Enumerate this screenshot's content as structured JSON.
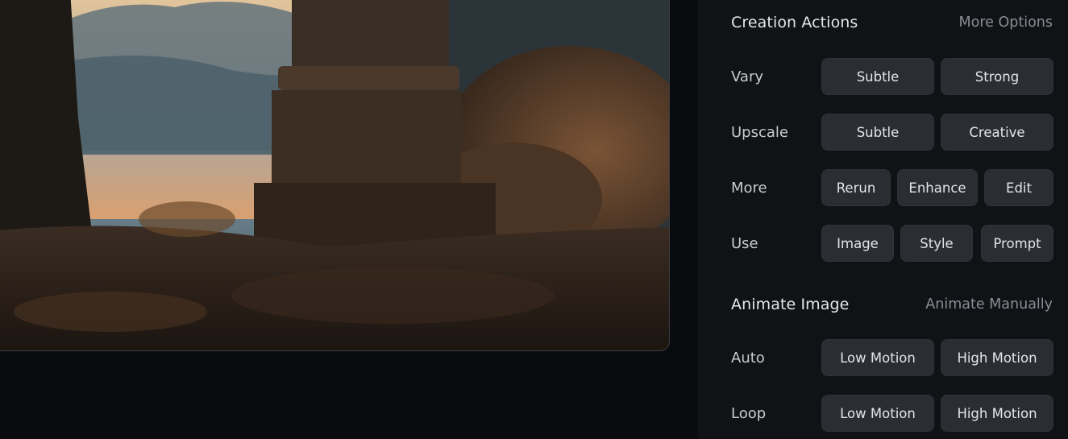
{
  "creation": {
    "title": "Creation Actions",
    "link": "More Options",
    "rows": [
      {
        "label": "Vary",
        "buttons": [
          "Subtle",
          "Strong"
        ]
      },
      {
        "label": "Upscale",
        "buttons": [
          "Subtle",
          "Creative"
        ]
      },
      {
        "label": "More",
        "buttons": [
          "Rerun",
          "Enhance",
          "Edit"
        ]
      },
      {
        "label": "Use",
        "buttons": [
          "Image",
          "Style",
          "Prompt"
        ]
      }
    ]
  },
  "animate": {
    "title": "Animate Image",
    "link": "Animate Manually",
    "rows": [
      {
        "label": "Auto",
        "buttons": [
          "Low Motion",
          "High Motion"
        ]
      },
      {
        "label": "Loop",
        "buttons": [
          "Low Motion",
          "High Motion"
        ]
      }
    ]
  }
}
